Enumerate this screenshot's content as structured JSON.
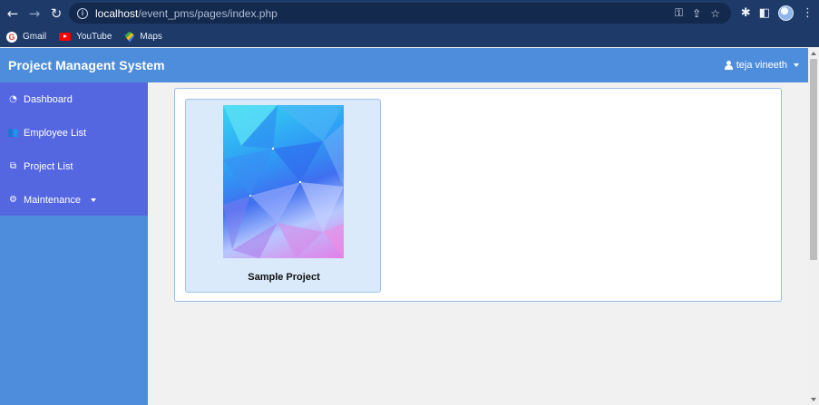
{
  "browser": {
    "url_host": "localhost",
    "url_path": "/event_pms/pages/index.php",
    "bookmarks": [
      {
        "label": "Gmail",
        "icon": "gmail-icon"
      },
      {
        "label": "YouTube",
        "icon": "youtube-icon"
      },
      {
        "label": "Maps",
        "icon": "maps-icon"
      }
    ]
  },
  "header": {
    "title": "Project Managent System",
    "user_name": "teja vineeth"
  },
  "sidebar": {
    "items": [
      {
        "label": "Dashboard",
        "icon": "dashboard-icon"
      },
      {
        "label": "Employee List",
        "icon": "users-icon"
      },
      {
        "label": "Project List",
        "icon": "copy-icon"
      },
      {
        "label": "Maintenance",
        "icon": "cogs-icon"
      }
    ]
  },
  "main": {
    "projects": [
      {
        "title": "Sample Project"
      }
    ]
  },
  "colors": {
    "chrome": "#1e3a68",
    "header": "#4d8ddb",
    "sidebar_active": "#5567e0",
    "card_bg": "#dbeafb"
  }
}
